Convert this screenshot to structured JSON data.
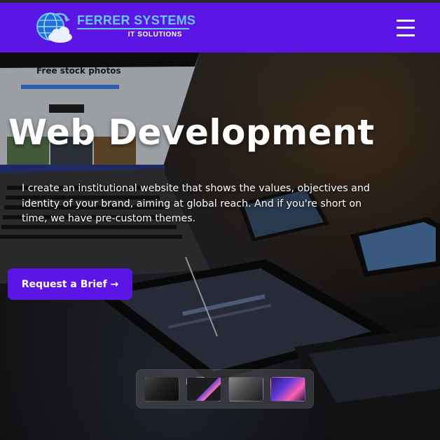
{
  "brand": {
    "name": "FERRER SYSTEMS",
    "tagline": "IT SOLUTIONS",
    "colors": {
      "primary": "#5b16e6",
      "logo_accent": "#66c8ff"
    }
  },
  "nav": {
    "menu_icon": "hamburger-menu-icon"
  },
  "hero": {
    "background_screen_heading": "Free stock photos",
    "title": "Web Development",
    "description": "I create an institutional website that shows the values, objectives and identity of your brand, aiming at global reach. And if you're short on time, we have pre-custom themes.",
    "cta_label": "Request a Brief →"
  },
  "carousel": {
    "thumbnails": [
      {
        "icon": "laptop-thumbnail"
      },
      {
        "icon": "phone-thumbnail"
      },
      {
        "icon": "desk-thumbnail"
      },
      {
        "icon": "keyboard-thumbnail"
      }
    ]
  }
}
